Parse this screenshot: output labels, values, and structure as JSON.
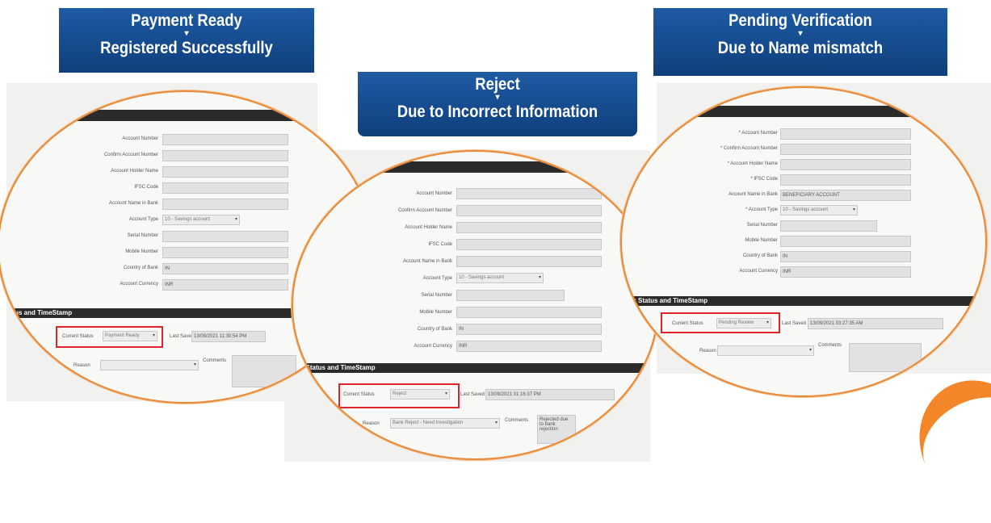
{
  "banners": [
    {
      "line1": "Payment Ready",
      "arrow": "▾",
      "line2": "Registered Successfully"
    },
    {
      "line1": "Reject",
      "arrow": "▾",
      "line2": "Due to Incorrect Information"
    },
    {
      "line1": "Pending Verification",
      "arrow": "▾",
      "line2": "Due to Name mismatch"
    }
  ],
  "colors": {
    "banner": "#1e5aa3",
    "ring": "#e88a3a",
    "highlight": "#e0222a",
    "bar": "#2b2b2b"
  },
  "screen1": {
    "fields": [
      "Account Number",
      "Confirm Account Number",
      "Account Holder Name",
      "IFSC Code",
      "Account Name in Bank",
      "Account Type",
      "Serial Number",
      "Mobile Number",
      "Country of Bank",
      "Account Currency"
    ],
    "account_type": "10 - Savings account",
    "country": "IN",
    "currency": "INR",
    "section": "Status and TimeStamp",
    "status_label": "Current Status",
    "status_value": "Payment Ready",
    "last_saved_label": "Last Saved",
    "last_saved_value": "13/09/2021 11:30:54 PM",
    "reason_label": "Reason",
    "comments_label": "Comments"
  },
  "screen2": {
    "fields": [
      "Account Number",
      "Confirm Account Number",
      "Account Holder Name",
      "IFSC Code",
      "Account Name in Bank",
      "Account Type",
      "Serial Number",
      "Mobile Number",
      "Country of Bank",
      "Account Currency"
    ],
    "account_type": "10 - Savings account",
    "country": "IN",
    "currency": "INR",
    "section": "nk Status and TimeStamp",
    "status_label": "Current Status",
    "status_value": "Reject",
    "last_saved_label": "Last Saved",
    "last_saved_value": "13/09/2021 01:16:37 PM",
    "reason_label": "Reason",
    "reason_value": "Bank Reject - Need Investigation",
    "comments_label": "Comments",
    "comments_value": "Rejected due to bank rejection"
  },
  "screen3": {
    "fields": [
      "* Account Number",
      "* Confirm Account Number",
      "* Account Holder Name",
      "* IFSC Code",
      "Account Name in Bank",
      "* Account Type",
      "Serial Number",
      "Mobile Number",
      "Country of Bank",
      "Account Currency"
    ],
    "account_name_in_bank": "BENEFICIARY ACCOUNT",
    "account_type": "10 - Savings account",
    "country": "IN",
    "currency": "INR",
    "section": "ank Status and TimeStamp",
    "status_label": "Current Status",
    "status_value": "Pending Review",
    "last_saved_label": "Last Saved",
    "last_saved_value": "13/09/2021 03:27:35 AM",
    "reason_label": "Reason",
    "comments_label": "Comments"
  }
}
